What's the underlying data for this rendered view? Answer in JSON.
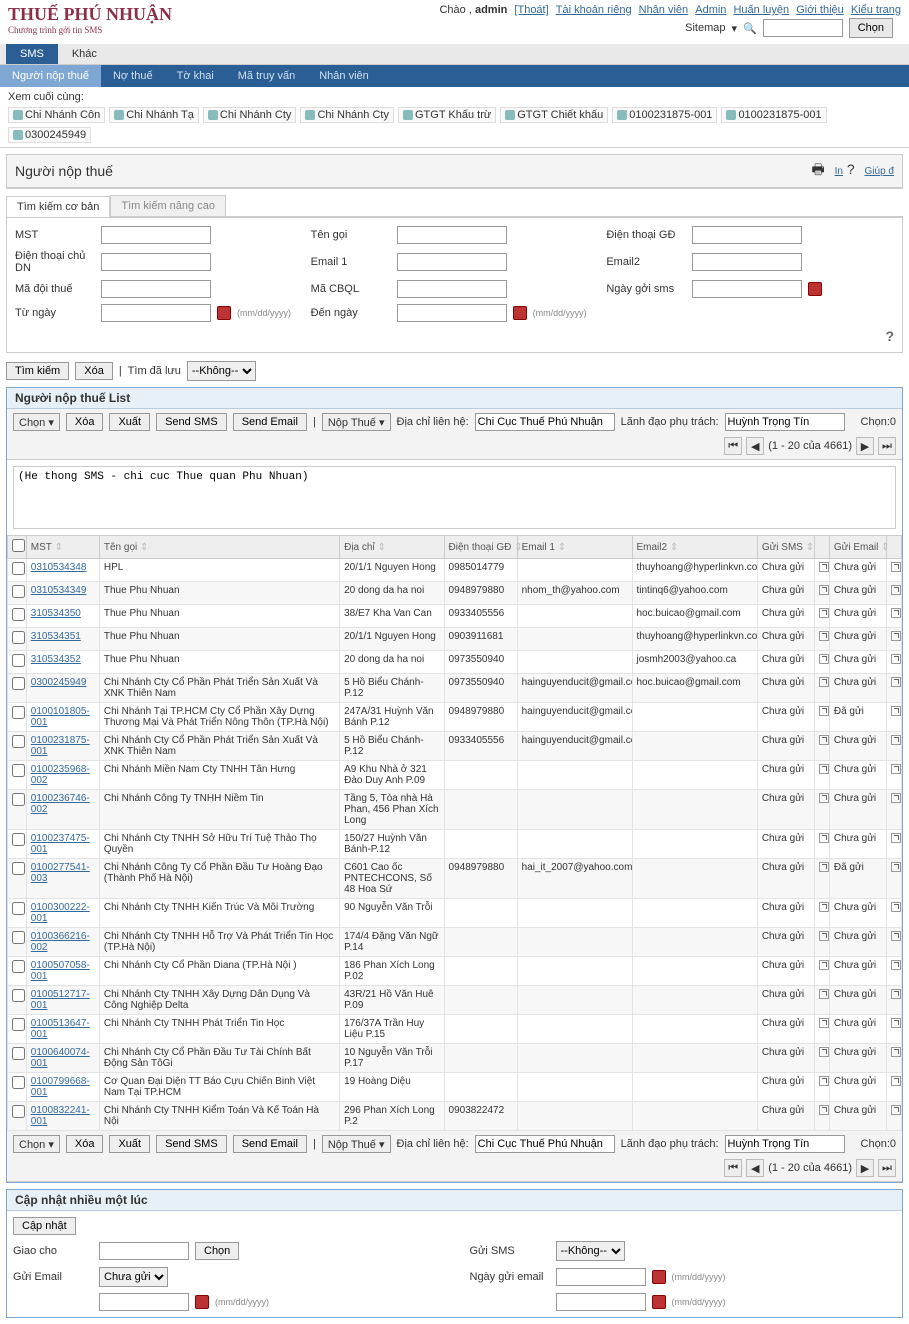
{
  "top": {
    "greeting": "Chào , ",
    "user": "admin",
    "logout": "[Thoát]",
    "links": [
      "Tài khoản riêng",
      "Nhân viên",
      "Admin",
      "Huấn luyện",
      "Giới thiệu",
      "Kiểu trang"
    ],
    "sitemap": "Sitemap",
    "choose": "Chọn"
  },
  "logo": {
    "l1": "THUẾ PHÚ NHUẬN",
    "l2": "Chương trình gởi tin SMS"
  },
  "tabs": [
    "SMS",
    "Khác"
  ],
  "subtabs": [
    "Người nộp thuế",
    "Nợ thuế",
    "Tờ khai",
    "Mã truy vấn",
    "Nhân viên"
  ],
  "recent": {
    "label": "Xem cuối cùng:",
    "items": [
      "Chi Nhánh Côn",
      "Chi Nhánh Tạ",
      "Chi Nhánh Cty",
      "Chi Nhánh Cty",
      "GTGT Khấu trừ",
      "GTGT Chiết khấu",
      "0100231875-001",
      "0100231875-001",
      "0300245949"
    ]
  },
  "page_title": "Người nộp thuế",
  "title_links": [
    "In",
    "Giúp đ"
  ],
  "searchtabs": [
    "Tìm kiếm cơ bản",
    "Tìm kiếm nâng cao"
  ],
  "sf": {
    "mst": "MST",
    "tengoi": "Tên gọi",
    "dtgd": "Điện thoại GĐ",
    "dtcdn": "Điện thoại chủ DN",
    "email1": "Email 1",
    "email2": "Email2",
    "madoithue": "Mã đội thuế",
    "macbql": "Mã CBQL",
    "ngaygoi": "Ngày gởi sms",
    "tungay": "Từ ngày",
    "denngay": "Đến ngày",
    "datefmt": "(mm/dd/yyyy)"
  },
  "buttons": {
    "timkiem": "Tìm kiếm",
    "xoa": "Xóa",
    "capnhat": "Cập nhật",
    "chon": "Chọn",
    "chonmenu": "Chọn"
  },
  "saved": {
    "label": "Tìm đã lưu",
    "none": "--Không--"
  },
  "list": {
    "title": "Người nộp thuế List",
    "chonmenu": "Chọn",
    "xoa": "Xóa",
    "xuat": "Xuất",
    "sendSms": "Send SMS",
    "sendEmail": "Send Email",
    "nopthue": "Nộp Thuế",
    "diachilh": "Địa chỉ liên hệ:",
    "diachilh_val": "Chi Cục Thuế Phú Nhuận",
    "lanhdao": "Lãnh đạo phụ trách:",
    "lanhdao_val": "Huỳnh Trọng Tín",
    "choncount": "Chọn:0",
    "pager": "(1 - 20 của 4661)",
    "note": "(He thong SMS - chi cuc Thue quan Phu Nhuan)"
  },
  "cols": [
    "MST",
    "Tên gọi",
    "Địa chỉ",
    "Điện thoại GĐ",
    "Email 1",
    "Email2",
    "Gửi SMS",
    "Gửi Email"
  ],
  "status": {
    "chuagui": "Chưa gửi",
    "dagui": "Đã gửi"
  },
  "rows": [
    {
      "mst": "0310534348",
      "ten": "HPL",
      "diachi": "20/1/1 Nguyen Hong",
      "dt": "0985014779",
      "e1": "",
      "e2": "thuyhoang@hyperlinkvn.com",
      "sms": "Chưa gửi",
      "em": "Chưa gửi"
    },
    {
      "mst": "0310534349",
      "ten": "Thue Phu Nhuan",
      "diachi": "20 dong da ha noi",
      "dt": "0948979880",
      "e1": "nhom_th@yahoo.com",
      "e2": "tintinq6@yahoo.com",
      "sms": "Chưa gửi",
      "em": "Chưa gửi"
    },
    {
      "mst": "310534350",
      "ten": "Thue Phu Nhuan",
      "diachi": "38/E7 Kha Van Can",
      "dt": "0933405556",
      "e1": "",
      "e2": "hoc.buicao@gmail.com",
      "sms": "Chưa gửi",
      "em": "Chưa gửi"
    },
    {
      "mst": "310534351",
      "ten": "Thue Phu Nhuan",
      "diachi": "20/1/1 Nguyen Hong",
      "dt": "0903911681",
      "e1": "",
      "e2": "thuyhoang@hyperlinkvn.com",
      "sms": "Chưa gửi",
      "em": "Chưa gửi"
    },
    {
      "mst": "310534352",
      "ten": "Thue Phu Nhuan",
      "diachi": "20 dong da ha noi",
      "dt": "0973550940",
      "e1": "",
      "e2": "josmh2003@yahoo.ca",
      "sms": "Chưa gửi",
      "em": "Chưa gửi"
    },
    {
      "mst": "0300245949",
      "ten": "Chi Nhánh Cty Cổ Phần Phát Triển Sản Xuất Và XNK Thiên Nam",
      "diachi": "5 Hồ Biểu Chánh-P.12",
      "dt": "0973550940",
      "e1": "hainguyenducit@gmail.com",
      "e2": "hoc.buicao@gmail.com",
      "sms": "Chưa gửi",
      "em": "Chưa gửi"
    },
    {
      "mst": "0100101805-001",
      "ten": "Chi Nhánh Tại TP.HCM Cty Cổ Phần Xây Dựng Thương Mại Và Phát Triển Nông Thôn (TP.Hà Nội)",
      "diachi": "247A/31 Huỳnh Văn Bánh P.12",
      "dt": "0948979880",
      "e1": "hainguyenducit@gmail.com",
      "e2": "",
      "sms": "Chưa gửi",
      "em": "Đã gửi"
    },
    {
      "mst": "0100231875-001",
      "ten": "Chi Nhánh Cty Cổ Phần Phát Triển Sản Xuất Và XNK Thiên Nam",
      "diachi": "5 Hồ Biểu Chánh-P.12",
      "dt": "0933405556",
      "e1": "hainguyenducit@gmail.com",
      "e2": "",
      "sms": "Chưa gửi",
      "em": "Chưa gửi"
    },
    {
      "mst": "0100235968-002",
      "ten": "Chi Nhánh Miền Nam Cty TNHH Tân Hưng",
      "diachi": "A9 Khu Nhà ở 321 Đào Duy Anh P.09",
      "dt": "",
      "e1": "",
      "e2": "",
      "sms": "Chưa gửi",
      "em": "Chưa gửi"
    },
    {
      "mst": "0100236746-002",
      "ten": "Chi Nhánh Công Ty TNHH Niềm Tin",
      "diachi": "Tầng 5, Tòa nhà Hà Phan, 456 Phan Xích Long",
      "dt": "",
      "e1": "",
      "e2": "",
      "sms": "Chưa gửi",
      "em": "Chưa gửi"
    },
    {
      "mst": "0100237475-001",
      "ten": "Chi Nhánh Cty TNHH Sở Hữu Trí Tuệ Thảo Thọ Quyền",
      "diachi": "150/27 Huỳnh Văn Bánh-P.12",
      "dt": "",
      "e1": "",
      "e2": "",
      "sms": "Chưa gửi",
      "em": "Chưa gửi"
    },
    {
      "mst": "0100277541-003",
      "ten": "Chi Nhánh Công Ty Cổ Phần Đầu Tư Hoàng Đạo (Thành Phố Hà Nội)",
      "diachi": "C601 Cao ốc PNTECHCONS, Số 48 Hoa Sứ",
      "dt": "0948979880",
      "e1": "hai_it_2007@yahoo.com",
      "e2": "",
      "sms": "Chưa gửi",
      "em": "Đã gửi"
    },
    {
      "mst": "0100300222-001",
      "ten": "Chi Nhánh Cty TNHH Kiến Trúc Và Môi Trường",
      "diachi": "90 Nguyễn Văn Trỗi",
      "dt": "",
      "e1": "",
      "e2": "",
      "sms": "Chưa gửi",
      "em": "Chưa gửi"
    },
    {
      "mst": "0100366216-002",
      "ten": "Chi Nhánh Cty TNHH Hỗ Trợ Và Phát Triển Tin Học (TP.Hà Nội)",
      "diachi": "174/4 Đặng Văn Ngữ P.14",
      "dt": "",
      "e1": "",
      "e2": "",
      "sms": "Chưa gửi",
      "em": "Chưa gửi"
    },
    {
      "mst": "0100507058-001",
      "ten": "Chi Nhánh Cty Cổ Phần Diana (TP.Hà Nội )",
      "diachi": "186 Phan Xích Long P.02",
      "dt": "",
      "e1": "",
      "e2": "",
      "sms": "Chưa gửi",
      "em": "Chưa gửi"
    },
    {
      "mst": "0100512717-001",
      "ten": "Chi Nhánh Cty TNHH Xây Dựng Dân Dụng Và Công Nghiệp Delta",
      "diachi": "43R/21 Hồ Văn Huê P.09",
      "dt": "",
      "e1": "",
      "e2": "",
      "sms": "Chưa gửi",
      "em": "Chưa gửi"
    },
    {
      "mst": "0100513647-001",
      "ten": "Chi Nhánh Cty TNHH Phát Triển Tin Học",
      "diachi": "176/37A Trần Huy Liệu P.15",
      "dt": "",
      "e1": "",
      "e2": "",
      "sms": "Chưa gửi",
      "em": "Chưa gửi"
    },
    {
      "mst": "0100640074-001",
      "ten": "Chi Nhánh Cty Cổ Phần Đầu Tư Tài Chính Bất Động Sản TôGi",
      "diachi": "10 Nguyễn Văn Trỗi P.17",
      "dt": "",
      "e1": "",
      "e2": "",
      "sms": "Chưa gửi",
      "em": "Chưa gửi"
    },
    {
      "mst": "0100799668-001",
      "ten": "Cơ Quan Đại Diện TT Báo Cựu Chiến Binh Việt Nam Tại TP.HCM",
      "diachi": "19 Hoàng Diệu",
      "dt": "",
      "e1": "",
      "e2": "",
      "sms": "Chưa gửi",
      "em": "Chưa gửi"
    },
    {
      "mst": "0100832241-001",
      "ten": "Chi Nhánh Cty TNHH Kiểm Toán Và Kế Toán Hà Nội",
      "diachi": "296 Phan Xích Long P.2",
      "dt": "0903822472",
      "e1": "",
      "e2": "",
      "sms": "Chưa gửi",
      "em": "Chưa gửi"
    }
  ],
  "update": {
    "title": "Cập nhật nhiều một lúc",
    "giaocho": "Giao cho",
    "guiSms": "Gửi SMS",
    "guiEmail": "Gửi Email",
    "ngayGuiEmail": "Ngày gửi email",
    "chuagui": "Chưa gửi",
    "none": "--Không--",
    "datefmt": "(mm/dd/yyyy)"
  }
}
